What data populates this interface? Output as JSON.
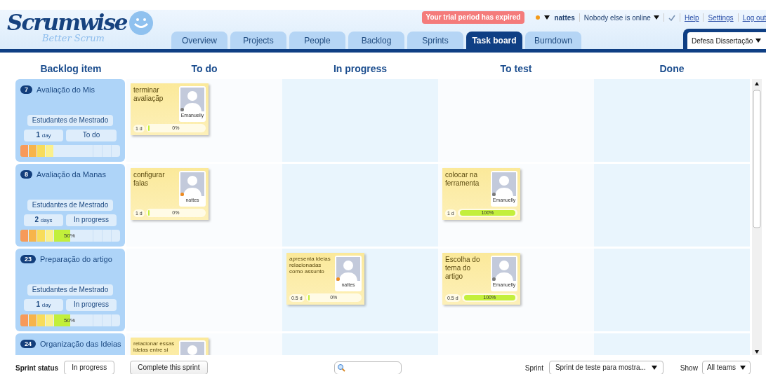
{
  "logo": {
    "name": "Scrumwise",
    "tagline": "Better Scrum"
  },
  "tabs": [
    {
      "label": "Overview",
      "selected": false
    },
    {
      "label": "Projects",
      "selected": false
    },
    {
      "label": "People",
      "selected": false
    },
    {
      "label": "Backlog",
      "selected": false
    },
    {
      "label": "Sprints",
      "selected": false
    },
    {
      "label": "Task board",
      "selected": true
    },
    {
      "label": "Burndown",
      "selected": false
    }
  ],
  "trial_notice": "Your trial period has expired",
  "user": {
    "name": "nattes",
    "online": true
  },
  "presence": "Nobody else is online",
  "links": [
    "Help",
    "Settings",
    "Log out"
  ],
  "project": "Defesa Dissertação",
  "columns": [
    "Backlog item",
    "To do",
    "In progress",
    "To test",
    "Done"
  ],
  "rows": [
    {
      "item": {
        "number": "7",
        "title": "Avaliação do Mis",
        "team": "Estudantes de Mestrado",
        "estimate": "1",
        "unit": "day",
        "status": "To do",
        "level": 0
      },
      "cells": [
        [
          {
            "title": "terminar avaliaçãp",
            "assignee": "Emanuelly",
            "online": false,
            "estimate": "1 d",
            "progress": "0%",
            "level": 0,
            "compact": false
          }
        ],
        [],
        [],
        []
      ]
    },
    {
      "item": {
        "number": "8",
        "title": "Avaliação da Manas",
        "team": "Estudantes de Mestrado",
        "estimate": "2",
        "unit": "days",
        "status": "In progress",
        "level": 0.5,
        "percent": "50%"
      },
      "cells": [
        [
          {
            "title": "configurar falas",
            "assignee": "nattes",
            "online": true,
            "estimate": "1 d",
            "progress": "0%",
            "level": 0,
            "compact": false
          }
        ],
        [],
        [
          {
            "title": "colocar na ferramenta",
            "assignee": "Emanuelly",
            "online": false,
            "estimate": "1 d",
            "progress": "100%",
            "level": 1,
            "compact": false
          }
        ],
        []
      ]
    },
    {
      "item": {
        "number": "23",
        "title": "Preparação do artigo",
        "team": "Estudantes de Mestrado",
        "estimate": "1",
        "unit": "day",
        "status": "In progress",
        "level": 0.5,
        "percent": "50%"
      },
      "cells": [
        [],
        [
          {
            "title": "apresenta ideias relacionadas como assunto",
            "assignee": "nattes",
            "online": true,
            "estimate": "0.5 d",
            "progress": "0%",
            "level": 0,
            "compact": true
          }
        ],
        [
          {
            "title": "Escolha do tema do artigo",
            "assignee": "Emanuelly",
            "online": false,
            "estimate": "0.5 d",
            "progress": "100%",
            "level": 1,
            "compact": false
          }
        ],
        []
      ]
    },
    {
      "item": {
        "number": "24",
        "title": "Organização das Ideias"
      },
      "cells": [
        [
          {
            "title": "relacionar essas ideias entre si",
            "compact": true
          }
        ],
        [],
        [],
        []
      ]
    }
  ],
  "footer": {
    "status_label": "Sprint status",
    "status": "In progress",
    "complete_button": "Complete this sprint",
    "sprint_label": "Sprint",
    "sprint": "Sprint de teste para mostra...",
    "show_label": "Show",
    "teams": "All teams"
  }
}
